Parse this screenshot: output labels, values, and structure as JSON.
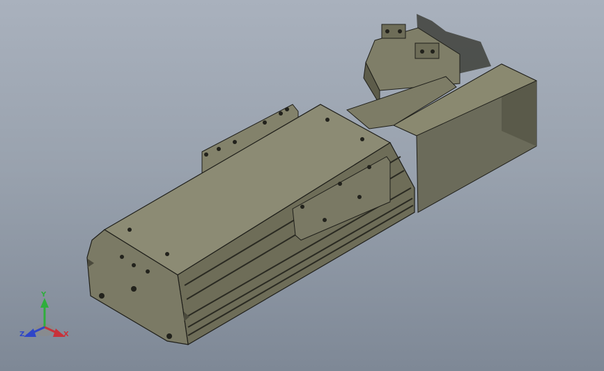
{
  "triad": {
    "x_label": "X",
    "y_label": "Y",
    "z_label": "Z",
    "colors": {
      "x": "#c8323a",
      "y": "#2fae3c",
      "z": "#2f46c8"
    }
  },
  "model": {
    "colors": {
      "body_top": "#8c8b74",
      "body_side": "#6e6d58",
      "body_dark": "#4b4a3c",
      "end_cap": "#7b7a65",
      "motor_front": "#6b6b5a",
      "motor_side": "#5a5a4a",
      "outline": "#1f1f1a"
    }
  }
}
